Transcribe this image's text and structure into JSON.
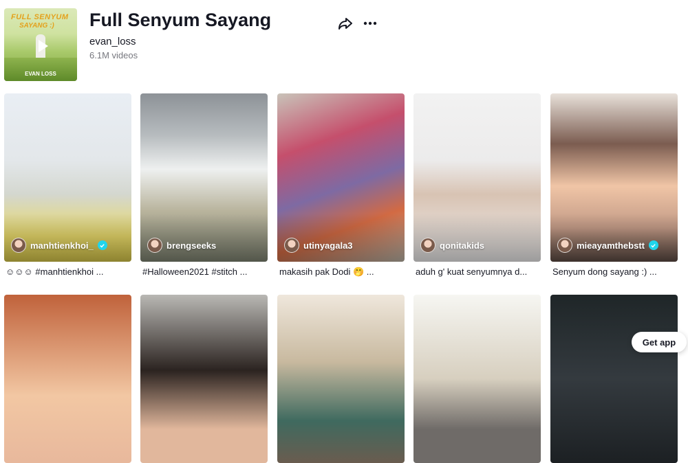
{
  "sound": {
    "cover_text_line1": "FULL SENYUM",
    "cover_text_line2": "SAYANG :)",
    "cover_label": "EVAN LOSS",
    "title": "Full Senyum Sayang",
    "artist": "evan_loss",
    "video_count": "6.1M videos"
  },
  "videos": [
    {
      "username": "manhtienkhoi_",
      "verified": true,
      "caption": "☺☺☺ #manhtienkhoi ..."
    },
    {
      "username": "brengseeks",
      "verified": false,
      "caption": "#Halloween2021 #stitch ..."
    },
    {
      "username": "utinyagala3",
      "verified": false,
      "caption": "makasih pak Dodi 🤭 ..."
    },
    {
      "username": "qonitakids",
      "verified": false,
      "caption": "aduh g' kuat senyumnya d..."
    },
    {
      "username": "mieayamthebstt",
      "verified": true,
      "caption": "Senyum dong sayang :) ..."
    }
  ],
  "get_app_label": "Get app",
  "colors": {
    "verified": "#20d5ec",
    "text": "#161823"
  }
}
